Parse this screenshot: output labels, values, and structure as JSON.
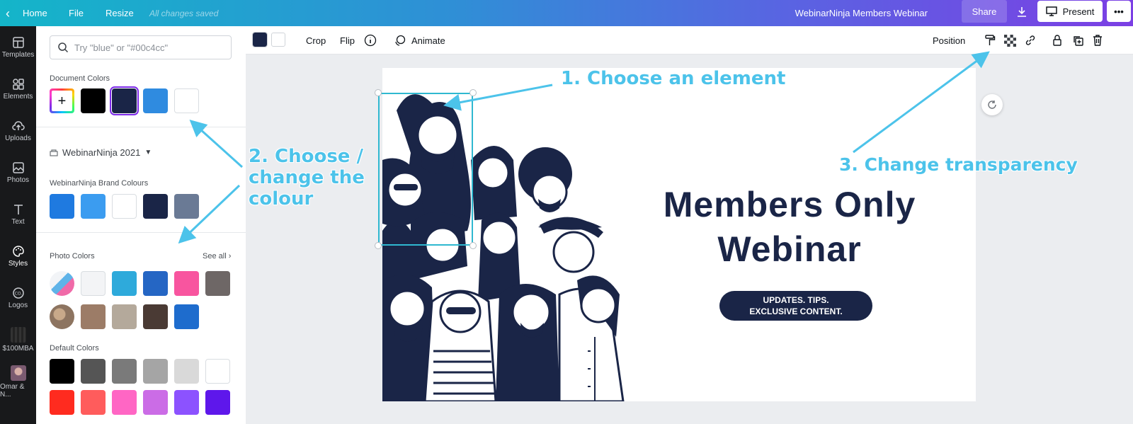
{
  "topbar": {
    "home": "Home",
    "file": "File",
    "resize": "Resize",
    "saved_status": "All changes saved",
    "doc_title": "WebinarNinja Members Webinar",
    "share": "Share",
    "present": "Present",
    "more": "•••"
  },
  "rail": {
    "templates": "Templates",
    "elements": "Elements",
    "uploads": "Uploads",
    "photos": "Photos",
    "text": "Text",
    "styles": "Styles",
    "logos": "Logos",
    "folder1": "$100MBA",
    "folder2": "Omar & N..."
  },
  "panel": {
    "search_placeholder": "Try \"blue\" or \"#00c4cc\"",
    "document_colors_title": "Document Colors",
    "document_colors": [
      "#000000",
      "#1a2547",
      "#2f8be0",
      "#ffffff"
    ],
    "brand_kit": "WebinarNinja 2021",
    "brand_title": "WebinarNinja Brand Colours",
    "brand_colors": [
      "#1f7ae0",
      "#3b9cf0",
      "#ffffff",
      "#1a2547",
      "#6a7a95"
    ],
    "photo_title": "Photo Colors",
    "see_all": "See all",
    "photo_colors_row1": [
      "#f3f4f6",
      "#2eaadb",
      "#2566c4",
      "#f8559f",
      "#6e6766"
    ],
    "photo_colors_row2": [
      "#9c7c67",
      "#b4a99b",
      "#4a3a34",
      "#1e6ccd"
    ],
    "default_title": "Default Colors",
    "default_row1": [
      "#000000",
      "#555555",
      "#7a7a7a",
      "#a5a5a5",
      "#d9d9d9",
      "#ffffff"
    ],
    "default_row2": [
      "#ff2b1f",
      "#ff5c5c",
      "#ff66c4",
      "#cb6ce6",
      "#8c52ff",
      "#5e17eb"
    ]
  },
  "toolbar": {
    "crop": "Crop",
    "flip": "Flip",
    "animate": "Animate",
    "position": "Position"
  },
  "slide": {
    "headline_line1": "Members Only",
    "headline_line2": "Webinar",
    "pill_line1": "UPDATES. TIPS.",
    "pill_line2": "EXCLUSIVE CONTENT."
  },
  "annotations": {
    "a1": "1. Choose an element",
    "a2_line1": "2. Choose /",
    "a2_line2": "change the",
    "a2_line3": "colour",
    "a3": "3. Change transparency"
  },
  "colors": {
    "accent": "#4cc3ea",
    "navy": "#1a2547",
    "selection": "#2fb8d0"
  }
}
